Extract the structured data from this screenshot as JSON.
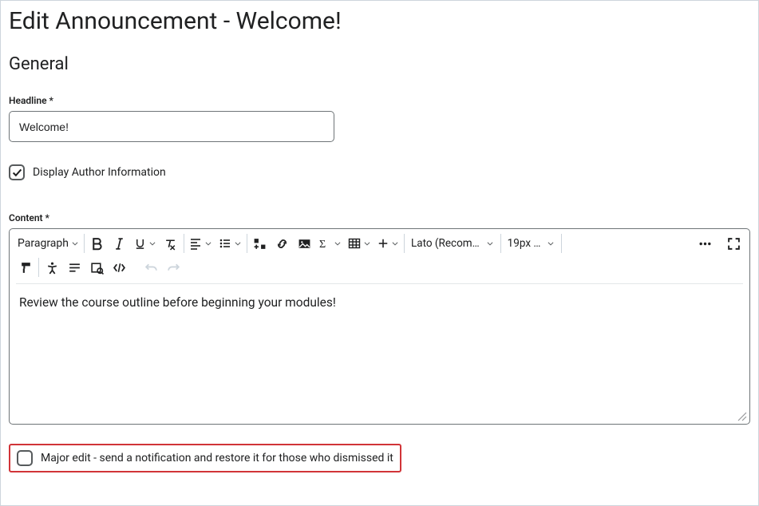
{
  "page": {
    "title": "Edit Announcement - Welcome!",
    "section": "General"
  },
  "headline": {
    "label": "Headline *",
    "value": "Welcome!"
  },
  "display_author": {
    "label": "Display Author Information",
    "checked": true
  },
  "content": {
    "label": "Content *",
    "body": "Review the course outline before beginning your modules!"
  },
  "toolbar": {
    "block_type": "Paragraph",
    "font_family": "Lato (Recom…",
    "font_size": "19px …"
  },
  "major_edit": {
    "label": "Major edit - send a notification and restore it for those who dismissed it",
    "checked": false
  }
}
